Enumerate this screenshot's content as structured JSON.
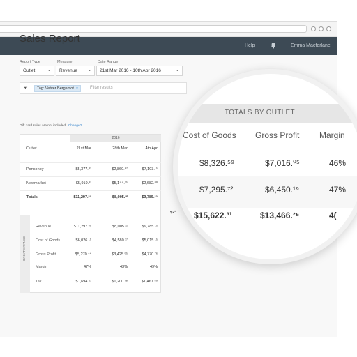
{
  "header": {
    "help": "Help",
    "user": "Emma Macfarlane"
  },
  "page": {
    "title": "Sales Report"
  },
  "filters": {
    "report_type": {
      "label": "Report Type",
      "value": "Outlet"
    },
    "measure": {
      "label": "Measure",
      "value": "Revenue"
    },
    "date_range": {
      "label": "Date Range",
      "value": "21st Mar 2016 - 10th Apr 2016"
    },
    "tag": "Tag: Vetver Bergamot",
    "search_placeholder": "Filter results"
  },
  "note": {
    "text": "Gift card sales are not included.",
    "link": "Change?"
  },
  "table": {
    "year": "2016",
    "columns": [
      "Outlet",
      "21st Mar",
      "28th Mar",
      "4th Apr"
    ],
    "rows": [
      {
        "label": "Ponsonby",
        "values": [
          "$5,377.⁸³",
          "$2,860.⁸⁷",
          "$7,103.¹⁵"
        ]
      },
      {
        "label": "Newmarket",
        "values": [
          "$5,919.³⁷",
          "$5,144.³⁵",
          "$2,682.⁰⁰"
        ]
      },
      {
        "label": "Totals",
        "values": [
          "$11,297.³⁹",
          "$8,005.²²",
          "$9,785.¹⁵"
        ]
      },
      {
        "label": "Revenue",
        "values": [
          "$11,297.³⁹",
          "$8,005.²²",
          "$9,785.¹⁵"
        ]
      },
      {
        "label": "Cost of Goods",
        "values": [
          "$6,026.¹⁵",
          "$4,580.¹⁷",
          "$5,015.¹⁵"
        ]
      },
      {
        "label": "Gross Profit",
        "values": [
          "$5,270.⁴⁴",
          "$3,425.⁰⁵",
          "$4,770.⁷⁶"
        ]
      },
      {
        "label": "Margin",
        "values": [
          "47%",
          "43%",
          "49%"
        ]
      },
      {
        "label": "Tax",
        "values": [
          "$1,694.⁶¹",
          "$1,200.⁷⁸",
          "$1,467.⁸⁹"
        ]
      }
    ],
    "side_label": "TOTALS BY DATE RANGE",
    "peek": "$2¹"
  },
  "magnifier": {
    "title": "TOTALS BY OUTLET",
    "columns": [
      "Cost of Goods",
      "Gross Profit",
      "Margin"
    ],
    "rows": [
      [
        "$8,326.⁵⁹",
        "$7,016.⁰⁵",
        "46%"
      ],
      [
        "$7,295.⁷²",
        "$6,450.¹⁹",
        "47%"
      ],
      [
        "$15,622.³¹",
        "$13,466.²⁵",
        "4("
      ]
    ]
  },
  "colors": {
    "header_bg": "#3d4a55",
    "accent": "#3a87cc",
    "tag_bg": "#dbe9f5"
  }
}
